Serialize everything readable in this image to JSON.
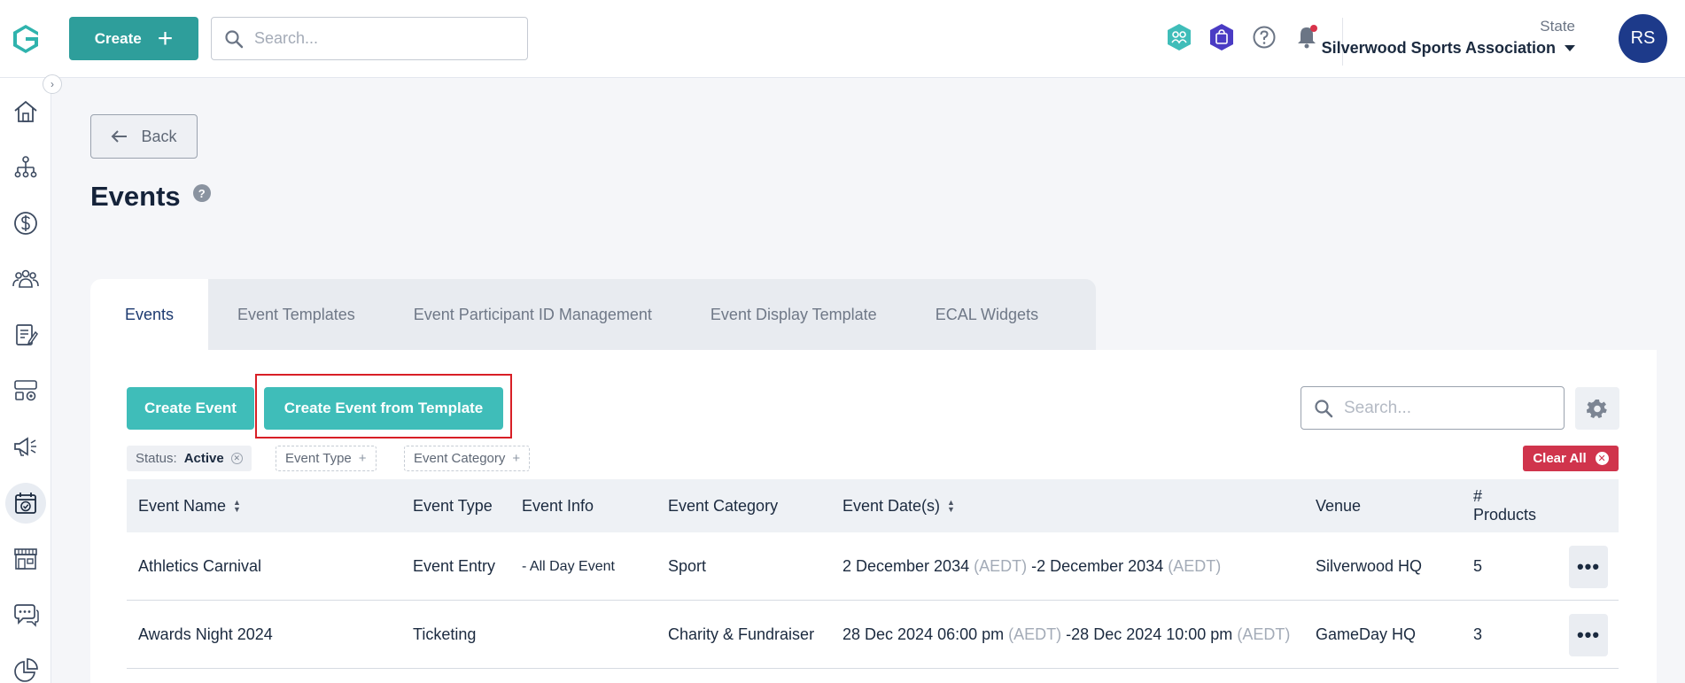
{
  "header": {
    "create_label": "Create",
    "search_placeholder": "Search...",
    "org_label": "State",
    "org_name": "Silverwood Sports Association",
    "avatar_initials": "RS",
    "brand_color": "#2e9e9b"
  },
  "sidebar": {
    "items": [
      {
        "icon": "home-icon"
      },
      {
        "icon": "org-tree-icon"
      },
      {
        "icon": "dollar-icon"
      },
      {
        "icon": "members-icon"
      },
      {
        "icon": "forms-icon"
      },
      {
        "icon": "widgets-icon"
      },
      {
        "icon": "megaphone-icon"
      },
      {
        "icon": "calendar-check-icon",
        "active": true
      },
      {
        "icon": "shop-icon"
      },
      {
        "icon": "chat-icon"
      },
      {
        "icon": "pie-chart-icon"
      }
    ]
  },
  "page": {
    "back_label": "Back",
    "title": "Events",
    "help_glyph": "?"
  },
  "tabs": [
    {
      "label": "Events",
      "active": true
    },
    {
      "label": "Event Templates"
    },
    {
      "label": "Event Participant ID Management"
    },
    {
      "label": "Event Display Template"
    },
    {
      "label": "ECAL Widgets"
    }
  ],
  "actions": {
    "create_event": "Create Event",
    "create_from_template": "Create Event from Template",
    "search_placeholder": "Search..."
  },
  "filters": {
    "status_label": "Status:",
    "status_value": "Active",
    "event_type": "Event Type",
    "event_category": "Event Category",
    "clear_all": "Clear All"
  },
  "table": {
    "columns": {
      "name": "Event Name",
      "type": "Event Type",
      "info": "Event Info",
      "category": "Event Category",
      "dates": "Event Date(s)",
      "venue": "Venue",
      "products_hash": "#",
      "products": "Products"
    },
    "rows": [
      {
        "name": "Athletics Carnival",
        "type": "Event Entry",
        "info": "- All Day Event",
        "category": "Sport",
        "start": "2 December 2034",
        "start_tz": "(AEDT)",
        "sep": "- ",
        "end": "2 December 2034",
        "end_tz": "(AEDT)",
        "venue": "Silverwood HQ",
        "products": "5"
      },
      {
        "name": "Awards Night 2024",
        "type": "Ticketing",
        "info": "",
        "category": "Charity & Fundraiser",
        "start": "28 Dec 2024 06:00 pm",
        "start_tz": "(AEDT)",
        "sep": "- ",
        "end": "28 Dec 2024 10:00 pm",
        "end_tz": "(AEDT)",
        "venue": "GameDay HQ",
        "products": "3"
      }
    ]
  }
}
